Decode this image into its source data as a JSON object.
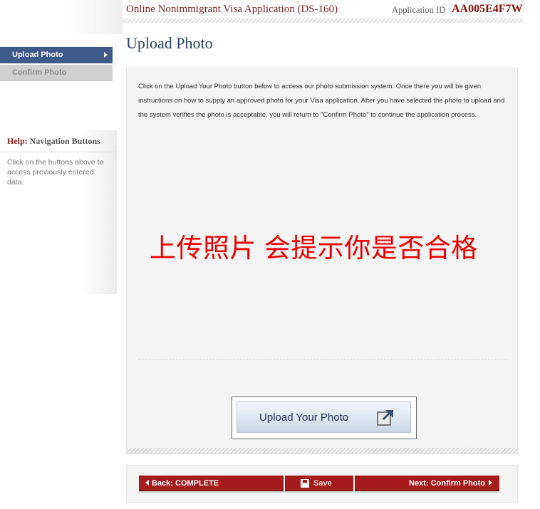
{
  "header": {
    "app_title": "Online Nonimmigrant Visa Application (DS-160)",
    "app_id_label": "Application ID",
    "app_id_value": "AA005E4F7W"
  },
  "sidebar": {
    "items": [
      {
        "label": "Upload Photo",
        "active": true
      },
      {
        "label": "Confirm Photo",
        "active": false
      }
    ],
    "help": {
      "title_prefix": "Help:",
      "title_rest": "Navigation Buttons",
      "text": "Click on the buttons above to access previously entered data."
    }
  },
  "main": {
    "page_title": "Upload Photo",
    "instructions": "Click on the Upload Your Photo button below to access our photo submission system. Once there you will be given instructions on how to supply an approved photo for your Visa application. After you have selected the photo to upload and the system verifies the photo is acceptable, you will return to \"Confirm Photo\" to continue the application process.",
    "overlay_note": "上传照片  会提示你是否合格",
    "upload_button_label": "Upload Your Photo"
  },
  "footer": {
    "back_label": "Back: COMPLETE",
    "save_label": "Save",
    "next_label": "Next: Confirm Photo"
  },
  "colors": {
    "accent_red": "#a51a1a",
    "nav_active": "#3d5a88",
    "title_blue": "#2c4267",
    "overlay_red": "#ee0000"
  },
  "icons": [
    "chevron-right-icon",
    "upload-photo-icon",
    "save-disk-icon",
    "triangle-left-icon",
    "triangle-right-icon"
  ]
}
